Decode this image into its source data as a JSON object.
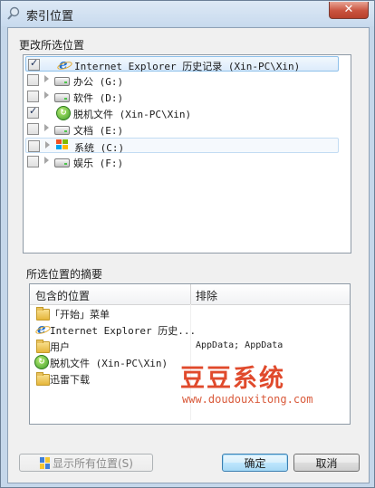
{
  "window": {
    "title": "索引位置",
    "close_label": "✕"
  },
  "change_section": {
    "title": "更改所选位置",
    "items": [
      {
        "label": "Internet Explorer 历史记录 (Xin-PC\\Xin)",
        "checked": true,
        "icon": "ie-icon",
        "expandable": false
      },
      {
        "label": "办公 (G:)",
        "checked": false,
        "icon": "drive-icon",
        "expandable": true
      },
      {
        "label": "软件 (D:)",
        "checked": false,
        "icon": "drive-icon",
        "expandable": true
      },
      {
        "label": "脱机文件 (Xin-PC\\Xin)",
        "checked": true,
        "icon": "sync-icon",
        "expandable": false
      },
      {
        "label": "文档 (E:)",
        "checked": false,
        "icon": "drive-icon",
        "expandable": true
      },
      {
        "label": "系统 (C:)",
        "checked": false,
        "icon": "windows-drive-icon",
        "expandable": true
      },
      {
        "label": "娱乐 (F:)",
        "checked": false,
        "icon": "drive-icon",
        "expandable": true
      }
    ]
  },
  "summary_section": {
    "title": "所选位置的摘要",
    "col_included": "包含的位置",
    "col_excluded": "排除",
    "rows": [
      {
        "location": "「开始」菜单",
        "excluded": "",
        "icon": "folder-icon"
      },
      {
        "location": "Internet Explorer 历史...",
        "excluded": "",
        "icon": "ie-icon"
      },
      {
        "location": "用户",
        "excluded": "AppData; AppData",
        "icon": "folder-icon"
      },
      {
        "location": "脱机文件 (Xin-PC\\Xin)",
        "excluded": "",
        "icon": "sync-icon"
      },
      {
        "location": "迅雷下载",
        "excluded": "",
        "icon": "folder-icon"
      }
    ]
  },
  "watermark": {
    "text": "豆豆系统",
    "url": "www.doudouxitong.com"
  },
  "buttons": {
    "show_all": "显示所有位置(S)",
    "ok": "确定",
    "cancel": "取消"
  },
  "colors": {
    "accent": "#3c7fb1",
    "watermark": "#e04a2c",
    "selection": "#dcebfb"
  }
}
